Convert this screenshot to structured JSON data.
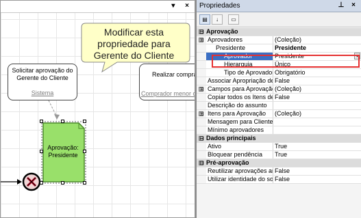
{
  "canvas": {
    "callout_lines": [
      "Modificar esta",
      "propriedade para",
      "Gerente do Cliente"
    ],
    "task1": {
      "title": "Solicitar aprovação do Gerente do Cliente",
      "link": "Sistema"
    },
    "task2": {
      "title": "Realizar compra",
      "link": "Comprador menor o"
    },
    "doc": {
      "label": "Aprovação: Presidente"
    },
    "colors": {
      "doc_fill": "#99e06a",
      "callout_fill": "#ffffc8"
    }
  },
  "panel": {
    "title": "Propriedades",
    "rows": [
      {
        "type": "cat",
        "exp": "⊟",
        "name": "Aprovação"
      },
      {
        "type": "prop",
        "exp": "⊞",
        "name": "Aprovadores",
        "value": "(Coleção)"
      },
      {
        "type": "prop",
        "exp": "⊟",
        "name": "Presidente",
        "value": "Presidente",
        "indent": 1,
        "bold": true
      },
      {
        "type": "prop",
        "name": "Aprovador",
        "value": "Presidente",
        "indent": 2,
        "selected": true
      },
      {
        "type": "prop",
        "name": "Hierarquia",
        "value": "Único",
        "indent": 2
      },
      {
        "type": "prop",
        "name": "Tipo de Aprovador",
        "value": "Obrigatório",
        "indent": 2
      },
      {
        "type": "prop",
        "name": "Associar Apropriação de",
        "value": "False"
      },
      {
        "type": "prop",
        "exp": "⊞",
        "name": "Campos para Aprovação",
        "value": "(Coleção)"
      },
      {
        "type": "prop",
        "name": "Copiar todos os Itens de",
        "value": "False"
      },
      {
        "type": "prop",
        "name": "Descrição do assunto",
        "value": ""
      },
      {
        "type": "prop",
        "exp": "⊞",
        "name": "Itens para Aprovação",
        "value": "(Coleção)"
      },
      {
        "type": "prop",
        "name": "Mensagem para Clientes",
        "value": ""
      },
      {
        "type": "prop",
        "name": "Mínimo aprovadores",
        "value": ""
      },
      {
        "type": "cat",
        "exp": "⊟",
        "name": "Dados principais"
      },
      {
        "type": "prop",
        "name": "Ativo",
        "value": "True"
      },
      {
        "type": "prop",
        "name": "Bloquear pendência",
        "value": "True"
      },
      {
        "type": "cat",
        "exp": "⊟",
        "name": "Pré-aprovação"
      },
      {
        "type": "prop",
        "name": "Reutilizar aprovações an",
        "value": "False"
      },
      {
        "type": "prop",
        "name": "Utilizar identidade do sol",
        "value": "False"
      }
    ]
  }
}
